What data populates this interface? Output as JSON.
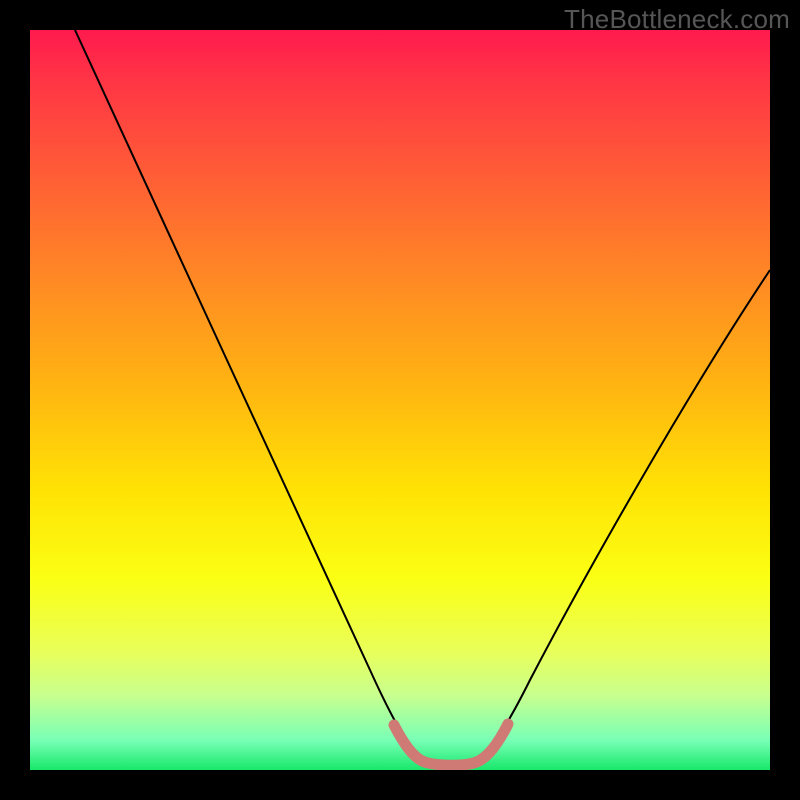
{
  "watermark": "TheBottleneck.com",
  "chart_data": {
    "type": "line",
    "title": "",
    "xlabel": "",
    "ylabel": "",
    "xlim": [
      0,
      100
    ],
    "ylim": [
      0,
      100
    ],
    "grid": false,
    "legend": false,
    "series": [
      {
        "name": "black-curve",
        "color": "#000000",
        "x": [
          6,
          10,
          15,
          20,
          25,
          30,
          35,
          40,
          45,
          48,
          50,
          52,
          54,
          56,
          58,
          60,
          62,
          65,
          70,
          75,
          80,
          85,
          90,
          95,
          100
        ],
        "y": [
          100,
          92,
          83,
          74,
          65,
          56,
          47,
          38,
          27,
          18,
          9,
          3,
          0.5,
          0.5,
          0.5,
          0.5,
          3,
          9,
          18,
          27,
          35,
          43,
          50,
          57,
          64
        ]
      },
      {
        "name": "highlight-trough",
        "color": "#d57a72",
        "x": [
          50,
          51,
          52,
          53,
          54,
          55,
          56,
          57,
          58,
          59,
          60,
          61
        ],
        "y": [
          6,
          3.5,
          2,
          1,
          0.7,
          0.6,
          0.6,
          0.7,
          1,
          2,
          3.5,
          6
        ]
      }
    ],
    "background_gradient_stops": [
      {
        "pos": 0,
        "color": "#ff1a4e"
      },
      {
        "pos": 62,
        "color": "#ffe205"
      },
      {
        "pos": 100,
        "color": "#17e86a"
      }
    ]
  }
}
